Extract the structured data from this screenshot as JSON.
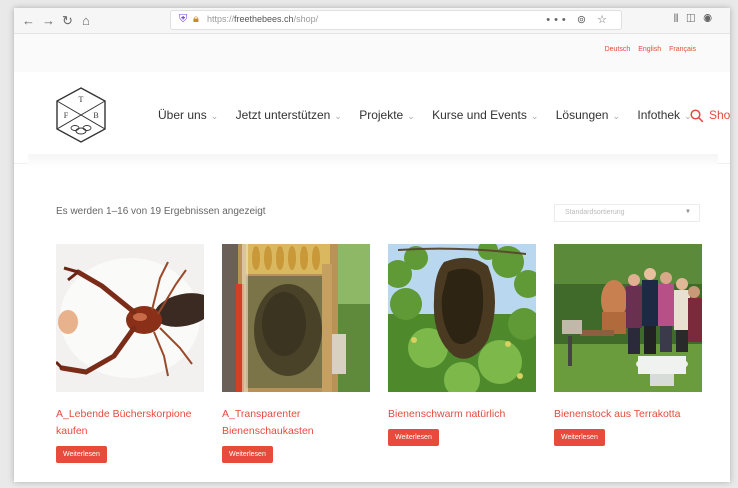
{
  "browser": {
    "url_prefix": "https://",
    "url_host": "freethebees.ch",
    "url_path": "/shop/",
    "overflow_menu": "•••"
  },
  "languages": [
    "Deutsch",
    "English",
    "Français"
  ],
  "brand": {
    "letters": [
      "F",
      "T",
      "B"
    ]
  },
  "nav": {
    "items": [
      {
        "label": "Über uns",
        "dropdown": true
      },
      {
        "label": "Jetzt unterstützen",
        "dropdown": true
      },
      {
        "label": "Projekte",
        "dropdown": true
      },
      {
        "label": "Kurse und Events",
        "dropdown": true
      },
      {
        "label": "Lösungen",
        "dropdown": true
      },
      {
        "label": "Infothek",
        "dropdown": true
      },
      {
        "label": "Shop",
        "dropdown": false,
        "active": true
      }
    ],
    "accent_color": "#e64b3c"
  },
  "shop": {
    "results_text": "Es werden 1–16 von 19 Ergebnissen angezeigt",
    "sort_placeholder": "Standardsortierung"
  },
  "products": [
    {
      "title": "A_Lebende Bücherskorpione kaufen",
      "button": "Weiterlesen",
      "image": "pseudoscorpion-macro"
    },
    {
      "title": "A_Transparenter Bienenschaukasten",
      "button": "Weiterlesen",
      "image": "observation-hive"
    },
    {
      "title": "Bienenschwarm natürlich",
      "button": "Weiterlesen",
      "image": "bee-swarm-on-branch"
    },
    {
      "title": "Bienenstock aus Terrakotta",
      "button": "Weiterlesen",
      "image": "terracotta-hive-garden"
    }
  ]
}
